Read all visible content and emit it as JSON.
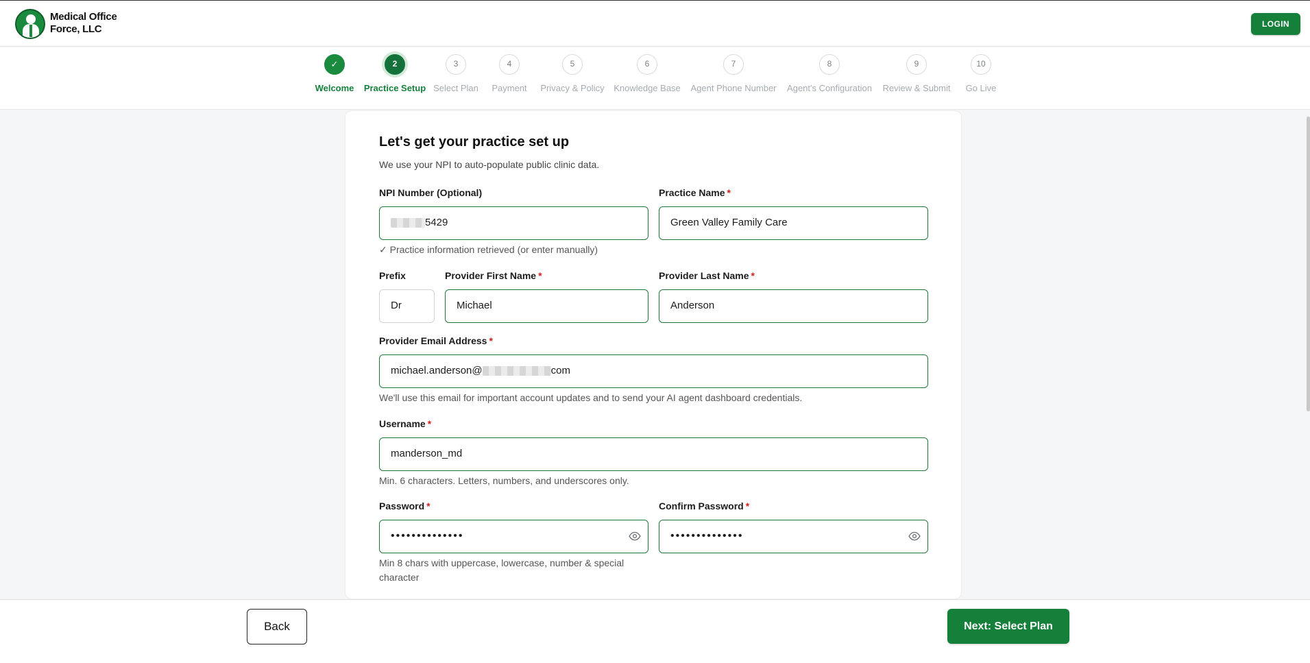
{
  "header": {
    "brand_line1": "Medical Office",
    "brand_line2": "Force, LLC",
    "login_label": "LOGIN"
  },
  "steps": [
    {
      "marker": "✓",
      "label": "Welcome",
      "state": "done"
    },
    {
      "marker": "2",
      "label": "Practice Setup",
      "state": "active"
    },
    {
      "marker": "3",
      "label": "Select Plan",
      "state": "pending"
    },
    {
      "marker": "4",
      "label": "Payment",
      "state": "pending"
    },
    {
      "marker": "5",
      "label": "Privacy & Policy",
      "state": "pending"
    },
    {
      "marker": "6",
      "label": "Knowledge Base",
      "state": "pending"
    },
    {
      "marker": "7",
      "label": "Agent Phone Number",
      "state": "pending"
    },
    {
      "marker": "8",
      "label": "Agent's Configuration",
      "state": "pending"
    },
    {
      "marker": "9",
      "label": "Review & Submit",
      "state": "pending"
    },
    {
      "marker": "10",
      "label": "Go Live",
      "state": "pending"
    }
  ],
  "form": {
    "title": "Let's get your practice set up",
    "subtitle": "We use your NPI to auto-populate public clinic data.",
    "required_mark": "*",
    "npi": {
      "label": "NPI Number (Optional)",
      "value_visible": "5429",
      "hint": "✓ Practice information retrieved (or enter manually)"
    },
    "practice_name": {
      "label": "Practice Name",
      "value": "Green Valley Family Care"
    },
    "prefix": {
      "label": "Prefix",
      "value": "Dr"
    },
    "first_name": {
      "label": "Provider First Name",
      "value": "Michael"
    },
    "last_name": {
      "label": "Provider Last Name",
      "value": "Anderson"
    },
    "email": {
      "label": "Provider Email Address",
      "value_start": "michael.anderson@",
      "value_end": "com",
      "hint": "We'll use this email for important account updates and to send your AI agent dashboard credentials."
    },
    "username": {
      "label": "Username",
      "value": "manderson_md",
      "hint": "Min. 6 characters. Letters, numbers, and underscores only."
    },
    "password": {
      "label": "Password",
      "masked": "••••••••••••••",
      "hint": "Min 8 chars with uppercase, lowercase, number & special character"
    },
    "confirm_password": {
      "label": "Confirm Password",
      "masked": "••••••••••••••"
    }
  },
  "footer": {
    "back_label": "Back",
    "next_label": "Next: Select Plan"
  },
  "colors": {
    "accent": "#14803a",
    "active_step": "#15713a",
    "required": "#d11d1d"
  },
  "icons": {
    "eye": "eye-icon",
    "check": "check-icon"
  }
}
